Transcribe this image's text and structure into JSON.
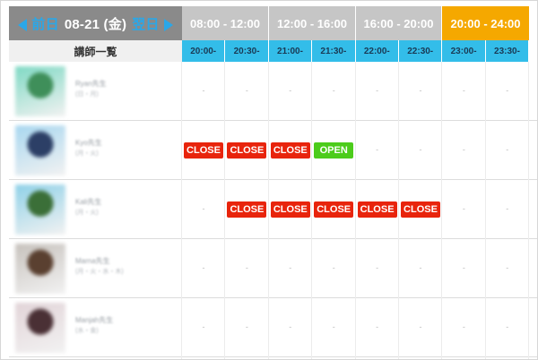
{
  "nav": {
    "prev_label": "前日",
    "date": "08-21 (金)",
    "next_label": "翌日"
  },
  "time_ranges": [
    {
      "label": "08:00 - 12:00",
      "active": false
    },
    {
      "label": "12:00 - 16:00",
      "active": false
    },
    {
      "label": "16:00 - 20:00",
      "active": false
    },
    {
      "label": "20:00 - 24:00",
      "active": true
    }
  ],
  "teacher_column_header": "講師一覧",
  "slots": [
    "20:00-",
    "20:30-",
    "21:00-",
    "21:30-",
    "22:00-",
    "22:30-",
    "23:00-",
    "23:30-"
  ],
  "teachers": [
    {
      "name": "Ryan先生",
      "sub": "(日・月)",
      "cells": [
        "-",
        "-",
        "-",
        "-",
        "-",
        "-",
        "-",
        "-"
      ]
    },
    {
      "name": "Kyo先生",
      "sub": "(月・火)",
      "cells": [
        "CLOSE",
        "CLOSE",
        "CLOSE",
        "OPEN",
        "-",
        "-",
        "-",
        "-"
      ]
    },
    {
      "name": "Kali先生",
      "sub": "(月・火)",
      "cells": [
        "-",
        "CLOSE",
        "CLOSE",
        "CLOSE",
        "CLOSE",
        "CLOSE",
        "-",
        "-"
      ]
    },
    {
      "name": "Marna先生",
      "sub": "(月・火・水・木)",
      "cells": [
        "-",
        "-",
        "-",
        "-",
        "-",
        "-",
        "-",
        "-"
      ]
    },
    {
      "name": "Manjah先生",
      "sub": "(水・金)",
      "cells": [
        "-",
        "-",
        "-",
        "-",
        "-",
        "-",
        "-",
        "-"
      ]
    }
  ],
  "colors": {
    "close": "#e8240c",
    "open": "#4ccc1b",
    "slot_header": "#33bde9",
    "active_range": "#f5a800",
    "inactive_range": "#c6c6c6",
    "nav_bg": "#8a8a8a",
    "nav_link": "#2aa7e8"
  }
}
